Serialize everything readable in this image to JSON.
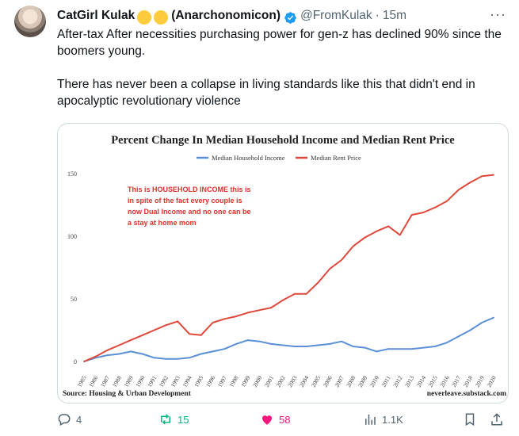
{
  "tweet": {
    "author_name": "CatGirl Kulak",
    "author_suffix": "(Anarchonomicon)",
    "handle": "@FromKulak",
    "separator": "·",
    "time": "15m",
    "more_label": "···",
    "text_1": "After-tax After necessities purchasing power for gen-z has declined 90% since the boomers young.",
    "text_2": "There has never been a collapse in living standards like this that didn't end in apocalyptic revolutionary violence"
  },
  "actions": {
    "reply_count": "4",
    "retweet_count": "15",
    "like_count": "58",
    "views_count": "1.1K"
  },
  "colors": {
    "retweet": "#00ba7c",
    "like": "#f91880",
    "income_line": "#5b8fd6",
    "rent_line": "#e0483b",
    "annotation": "#e0302a"
  },
  "chart_data": {
    "type": "line",
    "title": "Percent Change In Median Household Income and Median Rent Price",
    "xlabel": "",
    "ylabel": "",
    "x": [
      "1985",
      "1986",
      "1987",
      "1988",
      "1989",
      "1990",
      "1991",
      "1992",
      "1993",
      "1994",
      "1995",
      "1996",
      "1997",
      "1998",
      "1999",
      "2000",
      "2001",
      "2002",
      "2003",
      "2004",
      "2005",
      "2006",
      "2007",
      "2008",
      "2009",
      "2010",
      "2011",
      "2012",
      "2013",
      "2014",
      "2015",
      "2016",
      "2017",
      "2018",
      "2019",
      "2020"
    ],
    "yticks": [
      0,
      50,
      100,
      150
    ],
    "ylim": [
      0,
      150
    ],
    "grid": false,
    "legend_position": "top-center",
    "series": [
      {
        "name": "Median Household Income",
        "color": "#5b8fd6",
        "values": [
          0,
          3,
          5,
          6,
          8,
          6,
          3,
          2,
          2,
          3,
          6,
          8,
          10,
          14,
          17,
          16,
          14,
          13,
          12,
          12,
          13,
          14,
          16,
          12,
          11,
          8,
          10,
          10,
          10,
          11,
          12,
          15,
          20,
          25,
          31,
          35
        ]
      },
      {
        "name": "Median Rent Price",
        "color": "#e0483b",
        "values": [
          0,
          4,
          9,
          13,
          17,
          21,
          25,
          29,
          32,
          22,
          21,
          31,
          34,
          36,
          39,
          41,
          43,
          49,
          54,
          54,
          63,
          74,
          81,
          92,
          99,
          104,
          108,
          101,
          117,
          119,
          123,
          128,
          137,
          143,
          148,
          149
        ]
      }
    ],
    "annotation": "This is HOUSEHOLD INCOME this is in spite of the fact every couple is now Dual Income and no one can be a stay at home mom",
    "source": "Source: Housing & Urban Development",
    "credit": "neverleave.substack.com"
  }
}
